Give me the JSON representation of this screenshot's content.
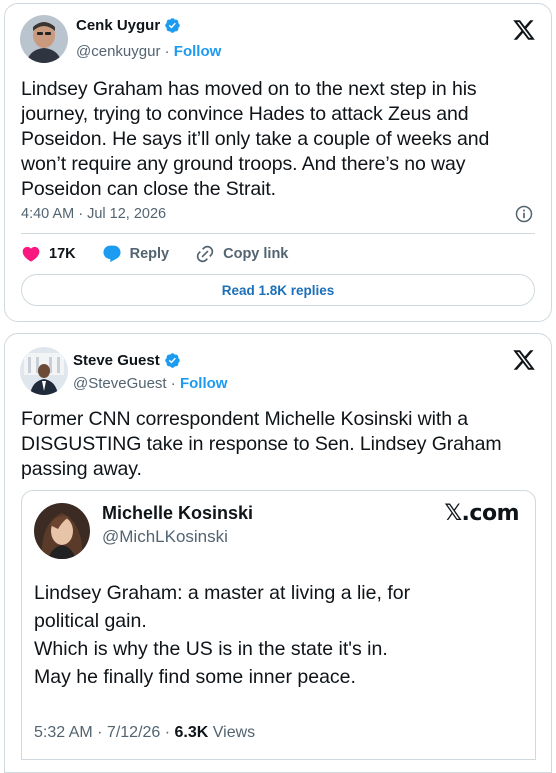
{
  "tweet1": {
    "author_name": "Cenk Uygur",
    "handle": "@cenkuygur",
    "separator": " · ",
    "follow_label": "Follow",
    "text_lines": [
      "Lindsey Graham has moved on to the next step in his",
      "journey, trying to convince Hades to attack Zeus and",
      "Poseidon. He says it’ll only take a couple of weeks and",
      "won’t require any ground troops. And there’s no way",
      "Poseidon can close the Strait."
    ],
    "timestamp": "4:40 AM · Jul 12, 2026",
    "likes": "17K",
    "reply_label": "Reply",
    "copy_link_label": "Copy link",
    "read_replies_label": "Read 1.8K replies"
  },
  "tweet2": {
    "author_name": "Steve Guest",
    "handle": "@SteveGuest",
    "separator": " · ",
    "follow_label": "Follow",
    "text_lines": [
      "Former CNN correspondent Michelle Kosinski with a",
      "DISGUSTING take in response to Sen. Lindsey Graham",
      "passing away."
    ],
    "embed": {
      "author_name": "Michelle Kosinski",
      "handle": "@MichLKosinski",
      "source": "𝕏.com",
      "text_lines": [
        "Lindsey Graham:  a master at living a lie, for",
        "political gain.",
        "Which is why the US is in the state it's in.",
        "May he finally find some inner peace."
      ],
      "timestamp": "5:32 AM · 7/12/26 · ",
      "views_count": "6.3K",
      "views_label": " Views"
    }
  },
  "colors": {
    "accent": "#1d9bf0",
    "like": "#f91880",
    "text": "#0f1419",
    "muted": "#536471",
    "border": "#cfd9de"
  },
  "icons": [
    "verified-badge-icon",
    "x-logo-icon",
    "info-icon",
    "heart-icon",
    "reply-bubble-icon",
    "link-icon"
  ]
}
